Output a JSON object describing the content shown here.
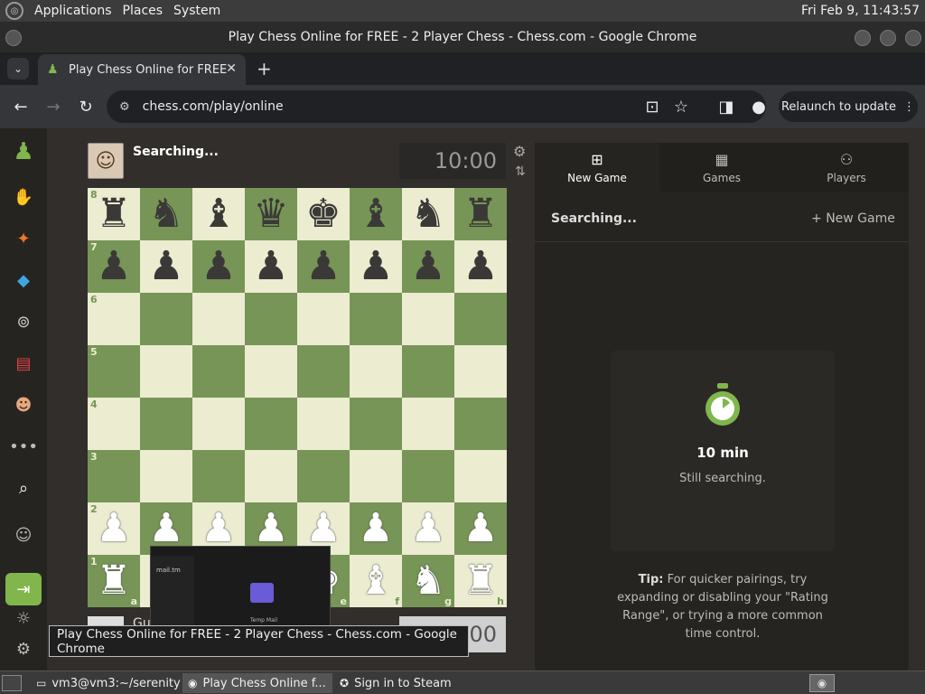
{
  "top_panel": {
    "menus": [
      "Applications",
      "Places",
      "System"
    ],
    "clock": "Fri Feb  9, 11:43:57"
  },
  "window": {
    "title": "Play Chess Online for FREE - 2 Player Chess - Chess.com - Google Chrome"
  },
  "tab": {
    "label": "Play Chess Online for FREE"
  },
  "toolbar": {
    "url": "chess.com/play/online",
    "relaunch_label": "Relaunch to update"
  },
  "game": {
    "opponent_name": "Searching...",
    "clock_top": "10:00",
    "clock_bottom": "10:00",
    "bottom_name": "Gu",
    "ranks": [
      "8",
      "7",
      "6",
      "5",
      "4",
      "3",
      "2",
      "1"
    ],
    "files": [
      "a",
      "b",
      "c",
      "d",
      "e",
      "f",
      "g",
      "h"
    ],
    "board": [
      [
        "♜",
        "♞",
        "♝",
        "♛",
        "♚",
        "♝",
        "♞",
        "♜"
      ],
      [
        "♟",
        "♟",
        "♟",
        "♟",
        "♟",
        "♟",
        "♟",
        "♟"
      ],
      [
        "",
        "",
        "",
        "",
        "",
        "",
        "",
        ""
      ],
      [
        "",
        "",
        "",
        "",
        "",
        "",
        "",
        ""
      ],
      [
        "",
        "",
        "",
        "",
        "",
        "",
        "",
        ""
      ],
      [
        "",
        "",
        "",
        "",
        "",
        "",
        "",
        ""
      ],
      [
        "♟",
        "♟",
        "♟",
        "♟",
        "♟",
        "♟",
        "♟",
        "♟"
      ],
      [
        "♜",
        "♞",
        "♝",
        "♛",
        "♚",
        "♝",
        "♞",
        "♜"
      ]
    ]
  },
  "right_panel": {
    "tabs": [
      {
        "label": "New Game",
        "icon": "plus-square-icon"
      },
      {
        "label": "Games",
        "icon": "checkerboard-icon"
      },
      {
        "label": "Players",
        "icon": "players-icon"
      }
    ],
    "searching_label": "Searching...",
    "new_game_label": "New Game",
    "time_label": "10 min",
    "still_searching": "Still searching.",
    "tip_prefix": "Tip:",
    "tip_text": " For quicker pairings, try expanding or disabling your \"Rating Range\", or trying a more common time control."
  },
  "tooltip": {
    "text": "Play Chess Online for FREE - 2 Player Chess - Chess.com - Google Chrome"
  },
  "thumbnail": {
    "brand": "mail.tm",
    "caption": "Temp Mail"
  },
  "taskbar": {
    "items": [
      {
        "label": "vm3@vm3:~/serenity",
        "icon": "terminal-icon"
      },
      {
        "label": "Play Chess Online f...",
        "icon": "chrome-icon"
      },
      {
        "label": "Sign in to Steam",
        "icon": "steam-icon"
      }
    ]
  },
  "colors": {
    "light_square": "#ebecd0",
    "dark_square": "#779556",
    "accent_green": "#81b64c"
  }
}
